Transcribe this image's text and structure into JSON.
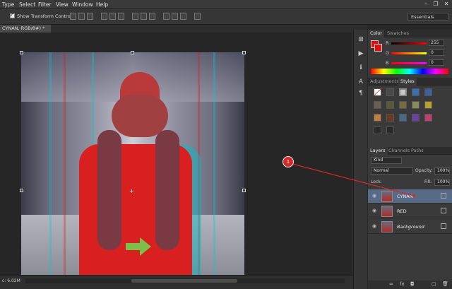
{
  "menu": [
    "Type",
    "Select",
    "Filter",
    "View",
    "Window",
    "Help"
  ],
  "window_controls": [
    "–",
    "❐",
    "✕"
  ],
  "options": {
    "show_transform_label": "Show Transform Controls",
    "workspace": "Essentials"
  },
  "document_tab": "CYNAN, RGB/8#) *",
  "status": {
    "doc_size": "c: 6.02M"
  },
  "color_panel": {
    "tabs": [
      "Color",
      "Swatches"
    ],
    "r_label": "R",
    "g_label": "G",
    "b_label": "B",
    "r_value": "255",
    "g_value": "0",
    "b_value": "0",
    "fg_color": "#e01010"
  },
  "adjust_panel": {
    "tabs": [
      "Adjustments",
      "Styles"
    ]
  },
  "layers_panel": {
    "tabs": [
      "Layers",
      "Channels",
      "Paths"
    ],
    "kind": "Kind",
    "blend_mode": "Normal",
    "opacity_label": "Opacity:",
    "opacity_value": "100%",
    "lock_label": "Lock:",
    "fill_label": "Fill:",
    "fill_value": "100%",
    "layers": [
      {
        "name": "CYNAN",
        "selected": true
      },
      {
        "name": "RED",
        "selected": false
      },
      {
        "name": "Background",
        "selected": false
      }
    ]
  },
  "callout": {
    "number": "1",
    "color": "#d42a2a"
  }
}
